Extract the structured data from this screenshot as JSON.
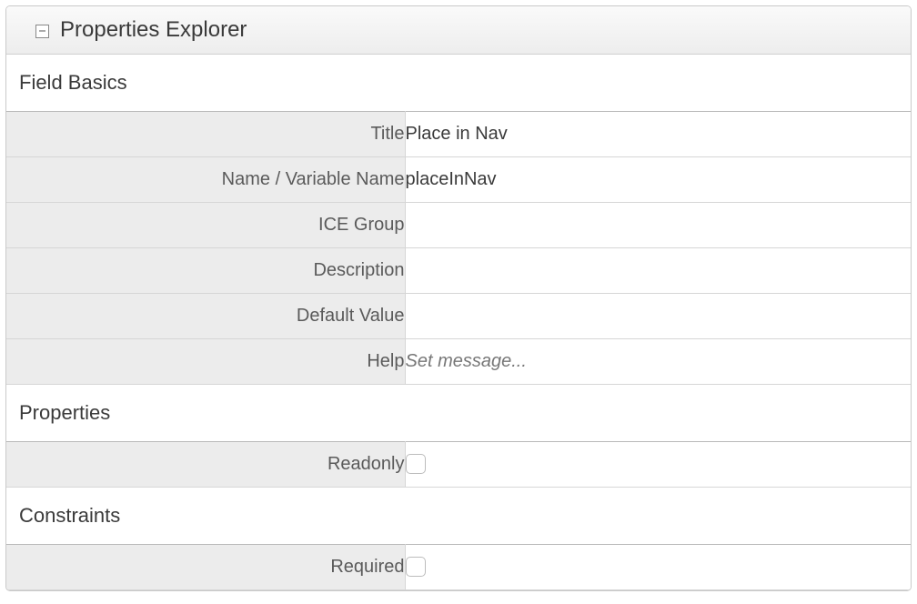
{
  "panel": {
    "title": "Properties Explorer"
  },
  "sections": {
    "field_basics": {
      "title": "Field Basics",
      "rows": {
        "title": {
          "label": "Title",
          "value": "Place in Nav"
        },
        "name": {
          "label": "Name / Variable Name",
          "value": "placeInNav"
        },
        "ice_group": {
          "label": "ICE Group",
          "value": ""
        },
        "description": {
          "label": "Description",
          "value": ""
        },
        "default_value": {
          "label": "Default Value",
          "value": ""
        },
        "help": {
          "label": "Help",
          "placeholder": "Set message..."
        }
      }
    },
    "properties": {
      "title": "Properties",
      "rows": {
        "readonly": {
          "label": "Readonly",
          "checked": false
        }
      }
    },
    "constraints": {
      "title": "Constraints",
      "rows": {
        "required": {
          "label": "Required",
          "checked": false
        }
      }
    }
  }
}
